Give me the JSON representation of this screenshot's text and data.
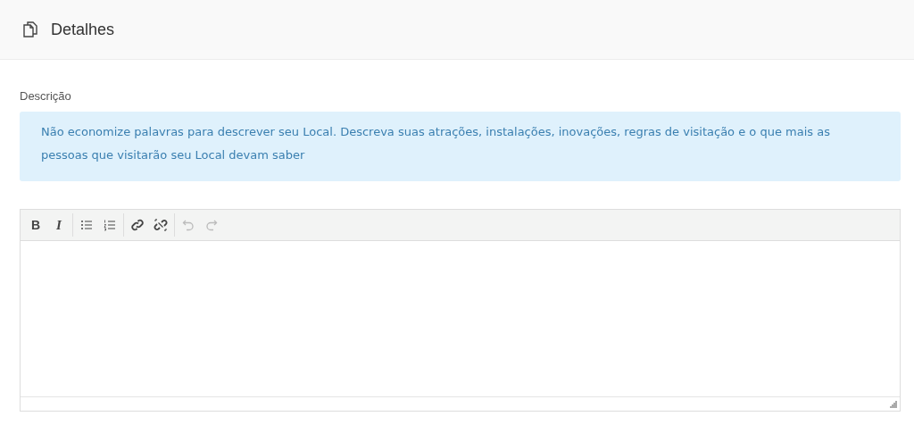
{
  "header": {
    "title": "Detalhes"
  },
  "field": {
    "label": "Descrição"
  },
  "info": "Não economize palavras para descrever seu Local. Descreva suas atrações, instalações, inovações, regras de visitação e o que mais as pessoas que visitarão seu Local devam saber",
  "toolbar": [
    [
      {
        "kind": "bold",
        "label": "B",
        "disabled": false
      },
      {
        "kind": "italic",
        "label": "I",
        "disabled": false
      }
    ],
    [
      {
        "kind": "bullets",
        "disabled": false
      },
      {
        "kind": "numbers",
        "disabled": false
      }
    ],
    [
      {
        "kind": "link",
        "disabled": false
      },
      {
        "kind": "unlink",
        "disabled": false
      }
    ],
    [
      {
        "kind": "undo",
        "disabled": true
      },
      {
        "kind": "redo",
        "disabled": true
      }
    ]
  ]
}
